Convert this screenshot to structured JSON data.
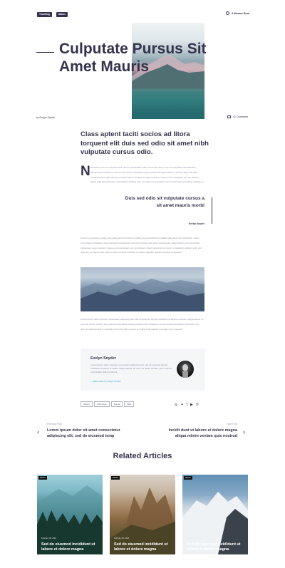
{
  "header": {
    "tags": [
      "Travelling",
      "Nature"
    ],
    "read_time": "3 Minutes Read"
  },
  "hero": {
    "title": "Culputate Pursus Sit Amet Mauris",
    "author": "by Evelyn Snyder",
    "comments": "42 Comments"
  },
  "article": {
    "lead": "Class aptent taciti socios ad litora torquent elit duis sed odio sit amet nibh vulputate cursus odio.",
    "dropcap": "N",
    "para1": "hendrerit, lorem non aptent taciti. Sed ut perspiciatis unde omnis iste natus error sit voluptatem accusantium doloremque laudantium. Nemo enim ipsam voluptatem quia voluptas sit aspernatur aut odit aut fugit, sed quia consequuntur magni dolores eos qui ratione voluptatem sequi nesciunt. Neque porro quisquam est, qui dolorem ipsum quia dolor sit amet, consectetur, adipisci velit, sed quia non numquam eius modi tempora incidunt ut labore et dolore magnam aliquam quaerat voluptatem.",
    "quote": "Duis sed odio sit vulputate cursus a sit amet mauris morbi",
    "quote_author": "Evelyn Snyder",
    "para2": "Totam rem aperiam, eaque ipsa quae ab illo inventore veritatis et quasi architecto beatae vitae dicta sunt explicabo. Nemo enim ipsam voluptatem quia voluptas sit aspernatur aut odit aut fugit, sed quia consequuntur magni dolores eos qui ratione voluptatem sequi nesciunt. Neque porro quisquam est, qui dolorem ipsum quia dolor sit amet, consectetur, adipisci velit, sed quia non numquam eius modi tempora incidunt ut labore et dolore magnam aliquam quaerat voluptatem.",
    "para3": "Lorem ipsum dolor sit amet, consectetur adipiscing elit, sed do eiusmod tempor incididunt ut labore et dolore magna aliqua. Ut enim ad minim veniam, quis nostrud exercitation ullamco laboris nisi ut aliquip ex ea commodo consequat. Duis aute irure dolor in reprehenderit in voluptate velit esse cillum dolore eu fugiat nulla pariatur excepteur sint occaecat."
  },
  "bio": {
    "name": "Evelyn Snyder",
    "text": "Lorem ipsum dolor sit amet, consectetur adipiscing elit, sed do eiusmod tempor incididunt ut labore et dolore magna aliqua. Ut enim ad minim veniam, quis nostrud exercitation ullamco laboris.",
    "link": "— Remember by Evelyn Snyder"
  },
  "tags": [
    "Nature",
    "Adventure",
    "Sports",
    "Wild"
  ],
  "social_icons": [
    "instagram-icon",
    "twitter-icon",
    "facebook-icon",
    "youtube-icon",
    "pinterest-icon"
  ],
  "post_nav": {
    "prev_label": "Previous Post",
    "prev_title": "Lorem ipsum dolor sit amet consectetur adipiscing elit, sed do eiusmod temp",
    "next_label": "Next Post",
    "next_title": "Incidit dunt ut labore et dolore magna aliqua minim veniam quis nostrud"
  },
  "related": {
    "heading": "Related Articles",
    "cards": [
      {
        "category": "Nature",
        "date": "February 04, 2021",
        "title": "Sed do eiusmod incididunt ut labore et dolore magna"
      },
      {
        "category": "Nature",
        "date": "February 04, 2021",
        "title": "Sed do eiusmod incididunt ut labore et dolore magna"
      },
      {
        "category": "Nature",
        "date": "February 04, 2021",
        "title": "Sed do eiusmod incididunt ut labore et dolore magna"
      }
    ]
  }
}
